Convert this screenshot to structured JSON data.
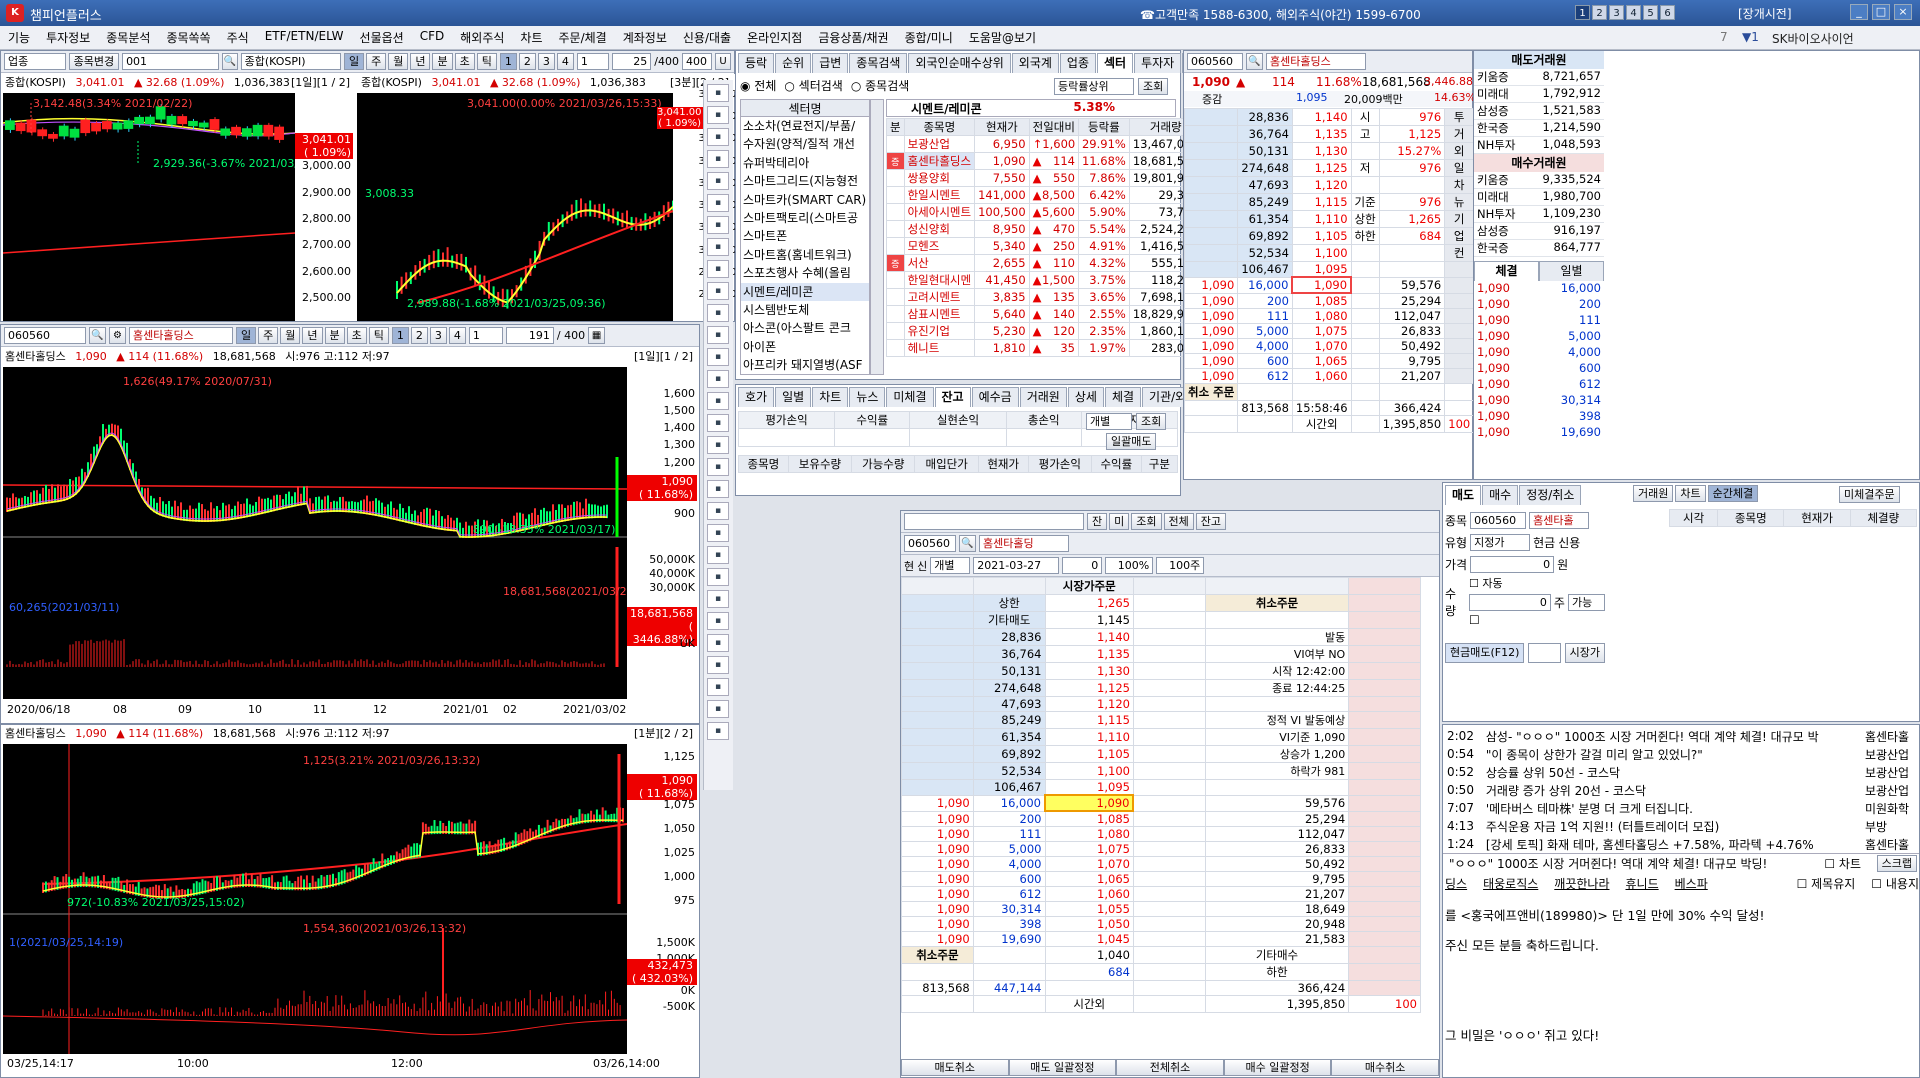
{
  "app": {
    "title": "챔피언플러스",
    "logo": "K",
    "call_center": "☎고객만족 1588-6300, 해외주식(야간) 1599-6700",
    "pages": [
      "1",
      "2",
      "3",
      "4",
      "5",
      "6"
    ],
    "market_status": "[장개시전]",
    "window_buttons": [
      "_",
      "□",
      "×"
    ]
  },
  "menu": [
    "기능",
    "투자정보",
    "종목분석",
    "종목쏙쏙",
    "주식",
    "ETF/ETN/ELW",
    "선물옵션",
    "CFD",
    "해외주식",
    "차트",
    "주문/체결",
    "계좌정보",
    "신용/대출",
    "온라인지점",
    "금융상품/채권",
    "종합/미니",
    "도움말@보기"
  ],
  "menu_extra": {
    "num": "7",
    "num2": "▼1",
    "promo": "SK바이오사이언"
  },
  "index_win": {
    "type": "업종",
    "change_btn": "종목변경",
    "code": "001",
    "name": "종합(KOSPI)",
    "periods": [
      "일",
      "주",
      "월",
      "년",
      "분",
      "초",
      "틱"
    ],
    "nums": [
      "1",
      "2",
      "3",
      "4"
    ],
    "sel1": "1",
    "count": "25",
    "max": "/400",
    "max2": "400",
    "info_left": {
      "name": "종합(KOSPI)",
      "price": "3,041.01",
      "chg": "▲ 32.68 (1.09%)",
      "vol": "1,036,383",
      "page": "[1일][1 / 2]"
    },
    "info_right": {
      "name": "종합(KOSPI)",
      "price": "3,041.01",
      "chg": "▲ 32.68 (1.09%)",
      "vol": "1,036,383",
      "page": "[3분][2 / 2]"
    },
    "left_axis": [
      "3,100.00",
      "3,000.00",
      "2,900.00",
      "2,800.00",
      "2,700.00",
      "2,600.00",
      "2,500.00"
    ],
    "left_price": "3,041.01",
    "left_pct": "( 1.09%)",
    "left_high": "3,142.48(3.34% 2021/02/22)",
    "left_low": "2,929.36(-3.67% 2021/03/09)",
    "right_axis": [
      "3,035.00",
      "3,030.00",
      "3,025.00",
      "3,020.00",
      "3,015.00",
      "3,010.00",
      "3,005.00",
      "3,000.00",
      "2,995.00",
      "2,990.00"
    ],
    "right_price": "3,041.00",
    "right_pct": "( 1.09%)",
    "right_high": "3,041.00(0.00% 2021/03/26,15:33)",
    "right_low": "2,989.88(-1.68% 2021/03/25,09:36)",
    "right_mid": "3,008.33"
  },
  "stock_win": {
    "code": "060560",
    "name": "홈센타홀딩스",
    "periods": [
      "일",
      "주",
      "월",
      "년",
      "분",
      "초",
      "틱"
    ],
    "nums": [
      "1",
      "2",
      "3",
      "4"
    ],
    "sel1": "1",
    "count": "191",
    "max": "/ 400",
    "info": {
      "name": "홈센타홀딩스",
      "price": "1,090",
      "chg": "▲ 114 (11.68%)",
      "vol": "18,681,568",
      "ohl": "시:976 고:112 저:97",
      "page": "[1일][1 / 2]"
    },
    "price_axis": [
      "1,600",
      "1,500",
      "1,400",
      "1,300",
      "1,200",
      "1,100",
      "1,000",
      "900"
    ],
    "vol_axis": [
      "50,000K",
      "40,000K",
      "30,000K"
    ],
    "cur": "1,090",
    "cur_pct": "( 11.68%)",
    "high": "1,626(49.17% 2020/07/31)",
    "low": "890(-18.35% 2021/03/17)",
    "vol_label": "18,681,568(2021/03/26)",
    "vol_cur": "18,681,568",
    "vol_pct": "( 3446.88%)",
    "vol_left": "60,265(2021/03/11)",
    "unit": "UK",
    "dates": [
      "2020/06/18",
      "08",
      "09",
      "10",
      "11",
      "12",
      "2021/01",
      "02",
      "2021/03/02"
    ]
  },
  "minute_win": {
    "info": {
      "name": "홈센타홀딩스",
      "price": "1,090",
      "chg": "▲ 114 (11.68%)",
      "vol": "18,681,568",
      "ohl": "시:976 고:112 저:97",
      "page": "[1분][2 / 2]"
    },
    "price_axis": [
      "1,125",
      "1,100",
      "1,075",
      "1,050",
      "1,025",
      "1,000",
      "975"
    ],
    "vol_axis": [
      "1,500K",
      "1,000K",
      "500K",
      "0K",
      "-500K"
    ],
    "cur": "1,090",
    "cur_pct": "( 11.68%)",
    "high": "1,125(3.21% 2021/03/26,13:32)",
    "low": "972(-10.83% 2021/03/25,15:02)",
    "vol_high": "1,554,360(2021/03/26,13:32)",
    "vol_cur": "432,473",
    "vol_pct": "( 432.03%)",
    "vol_left": "1(2021/03/25,14:19)",
    "dates": [
      "03/25,14:17",
      "10:00",
      "12:00",
      "03/26,14:00"
    ]
  },
  "sector_win": {
    "tabs": [
      "등락",
      "순위",
      "급변",
      "종목검색",
      "외국인순매수상위",
      "외국계",
      "업종",
      "섹터",
      "투자자",
      "프"
    ],
    "radios": [
      "전체",
      "섹터검색",
      "종목검색"
    ],
    "sort": "등락률상위",
    "query": "조회",
    "sector_header": "섹터명",
    "sector_sel": "시멘트/레미콘",
    "sector_pct": "5.38%",
    "sectors": [
      "소소차(연료전지/부품/",
      "수자원(양적/질적 개선",
      "슈퍼박테리아",
      "스마트그리드(지능형전",
      "스마트카(SMART CAR)",
      "스마트팩토리(스마트공",
      "스마트폰",
      "스마트홈(홈네트워크)",
      "스포츠행사 수혜(올림",
      "시멘트/레미콘",
      "시스템반도체",
      "아스콘(아스팔트 콘크",
      "아이폰",
      "아프리카 돼지열병(ASF"
    ],
    "cols": [
      "분",
      "종목명",
      "현재가",
      "전일대비",
      "등락률",
      "거래량"
    ],
    "rows": [
      {
        "m": "",
        "n": "보광산업",
        "p": "6,950",
        "a": "↑",
        "d": "1,600",
        "r": "29.91%",
        "v": "13,467,077",
        "nc": "red"
      },
      {
        "m": "증",
        "n": "홈센타홀딩스",
        "p": "1,090",
        "a": "▲",
        "d": "114",
        "r": "11.68%",
        "v": "18,681,568",
        "nc": "red"
      },
      {
        "m": "",
        "n": "쌍용양회",
        "p": "7,550",
        "a": "▲",
        "d": "550",
        "r": "7.86%",
        "v": "19,801,958",
        "nc": "red"
      },
      {
        "m": "",
        "n": "한일시멘트",
        "p": "141,000",
        "a": "▲",
        "d": "8,500",
        "r": "6.42%",
        "v": "29,378",
        "nc": "red"
      },
      {
        "m": "",
        "n": "아세아시멘트",
        "p": "100,500",
        "a": "▲",
        "d": "5,600",
        "r": "5.90%",
        "v": "73,727",
        "nc": "red"
      },
      {
        "m": "",
        "n": "성신양회",
        "p": "8,950",
        "a": "▲",
        "d": "470",
        "r": "5.54%",
        "v": "2,524,272",
        "nc": "red"
      },
      {
        "m": "",
        "n": "모헨즈",
        "p": "5,340",
        "a": "▲",
        "d": "250",
        "r": "4.91%",
        "v": "1,416,590",
        "nc": "red"
      },
      {
        "m": "증",
        "n": "서산",
        "p": "2,655",
        "a": "▲",
        "d": "110",
        "r": "4.32%",
        "v": "555,152",
        "nc": "red"
      },
      {
        "m": "",
        "n": "한일현대시멘",
        "p": "41,450",
        "a": "▲",
        "d": "1,500",
        "r": "3.75%",
        "v": "118,253",
        "nc": "red"
      },
      {
        "m": "",
        "n": "고려시멘트",
        "p": "3,835",
        "a": "▲",
        "d": "135",
        "r": "3.65%",
        "v": "7,698,190",
        "nc": "red"
      },
      {
        "m": "",
        "n": "삼표시멘트",
        "p": "5,640",
        "a": "▲",
        "d": "140",
        "r": "2.55%",
        "v": "18,829,924",
        "nc": "red"
      },
      {
        "m": "",
        "n": "유진기업",
        "p": "5,230",
        "a": "▲",
        "d": "120",
        "r": "2.35%",
        "v": "1,860,137",
        "nc": "red"
      },
      {
        "m": "",
        "n": "헤니트",
        "p": "1,810",
        "a": "▲",
        "d": "35",
        "r": "1.97%",
        "v": "283,027",
        "nc": "red"
      }
    ]
  },
  "account_win": {
    "tabs": [
      "호가",
      "일별",
      "차트",
      "뉴스",
      "미체결",
      "잔고",
      "예수금",
      "거래원",
      "상세",
      "체결",
      "기관/외인"
    ],
    "summary": [
      "평가손익",
      "수익률",
      "실현손익",
      "총손익",
      "추정자산"
    ],
    "mode": "개별",
    "query": "조회",
    "sell_all": "일괄매도",
    "cols": [
      "종목명",
      "보유수량",
      "가능수량",
      "매입단가",
      "현재가",
      "평가손익",
      "수익률",
      "구분"
    ]
  },
  "order_win": {
    "code": "060560",
    "name": "홈센타홀딩",
    "btns": [
      "잔",
      "미",
      "조회",
      "전체",
      "잔고"
    ],
    "radios": [
      "현",
      "신"
    ],
    "mode": "개별",
    "date": "2021-03-27",
    "qty": "0",
    "pct": "100%",
    "vol": "100주",
    "market_price_order": "시장가주문",
    "upper_label": "상한",
    "upper": "1,265",
    "etc_sell": "기타매도",
    "etc_val": "1,145",
    "cancel": "취소주문",
    "cancel2": "취소주문",
    "asks": [
      [
        "28,836",
        "1,140"
      ],
      [
        "36,764",
        "1,135"
      ],
      [
        "50,131",
        "1,130"
      ],
      [
        "274,648",
        "1,125"
      ],
      [
        "47,693",
        "1,120"
      ],
      [
        "85,249",
        "1,115"
      ],
      [
        "61,354",
        "1,110"
      ],
      [
        "69,892",
        "1,105"
      ],
      [
        "52,534",
        "1,100"
      ],
      [
        "106,467",
        "1,095"
      ]
    ],
    "bids": [
      [
        "1,090",
        "16,000",
        "1,090",
        "59,576"
      ],
      [
        "1,090",
        "200",
        "1,085",
        "25,294"
      ],
      [
        "1,090",
        "111",
        "1,080",
        "112,047"
      ],
      [
        "1,090",
        "5,000",
        "1,075",
        "26,833"
      ],
      [
        "1,090",
        "4,000",
        "1,070",
        "50,492"
      ],
      [
        "1,090",
        "600",
        "1,065",
        "9,795"
      ],
      [
        "1,090",
        "612",
        "1,060",
        "21,207"
      ],
      [
        "1,090",
        "30,314",
        "1,055",
        "18,649"
      ],
      [
        "1,090",
        "398",
        "1,050",
        "20,948"
      ],
      [
        "1,090",
        "19,690",
        "1,045",
        "21,583"
      ]
    ],
    "info": [
      [
        "발동",
        ""
      ],
      [
        "VI여부",
        "NO"
      ],
      [
        "시작",
        "12:42:00"
      ],
      [
        "종료",
        "12:44:25"
      ],
      [
        "",
        ""
      ],
      [
        "정적 VI 발동예상",
        ""
      ],
      [
        "VI기준",
        "1,090"
      ],
      [
        "상승가",
        "1,200"
      ],
      [
        "하락가",
        "981"
      ]
    ],
    "side_btns": [
      "투",
      "거",
      "외",
      "일",
      "차",
      "뉴",
      "기",
      "업",
      "컨"
    ],
    "bottom": {
      "low_val": "1,040",
      "low_label": "하한",
      "etc_buy": "기타매수",
      "low_price": "684",
      "total_ask": "813,568",
      "total_bid": "447,144",
      "after_label": "시간외",
      "after_ask": "366,424",
      "after_bid": "1,395,850",
      "hundred": "100"
    },
    "footer": [
      "매도취소",
      "매도 일괄정정",
      "전체취소",
      "매수 일괄정정",
      "매수취소"
    ]
  },
  "quote_win": {
    "code": "060560",
    "name": "홈센타홀딩스",
    "price": "1,090",
    "chg": "▲",
    "diff": "114",
    "pct": "11.68%",
    "vol": "18,681,568",
    "vol_pct": "3,446.88%",
    "prev_label": "증감",
    "prev": "1,095",
    "amt": "20,009백만",
    "amt_pct": "14.63%",
    "asks": [
      [
        "28,836",
        "1,140"
      ],
      [
        "36,764",
        "1,135"
      ],
      [
        "50,131",
        "1,130"
      ],
      [
        "274,648",
        "1,125"
      ],
      [
        "47,693",
        "1,120"
      ],
      [
        "85,249",
        "1,115"
      ],
      [
        "61,354",
        "1,110"
      ],
      [
        "69,892",
        "1,105"
      ],
      [
        "52,534",
        "1,100"
      ],
      [
        "106,467",
        "1,095"
      ]
    ],
    "bids": [
      [
        "1,090",
        "16,000",
        "1,090",
        "59,576"
      ],
      [
        "1,090",
        "200",
        "1,085",
        "25,294"
      ],
      [
        "1,090",
        "111",
        "1,080",
        "112,047"
      ],
      [
        "1,090",
        "5,000",
        "1,075",
        "26,833"
      ],
      [
        "1,090",
        "4,000",
        "1,070",
        "50,492"
      ],
      [
        "1,090",
        "600",
        "1,065",
        "9,795"
      ],
      [
        "1,090",
        "612",
        "1,060",
        "21,207"
      ]
    ],
    "stats": [
      [
        "시",
        "976"
      ],
      [
        "고",
        "1,125"
      ],
      [
        "",
        "15.27%"
      ],
      [
        "저",
        "976"
      ],
      [
        "",
        ""
      ],
      [
        "기준",
        "976"
      ],
      [
        "상한",
        "1,265"
      ],
      [
        "하한",
        "684"
      ]
    ],
    "side": [
      "투",
      "거",
      "외",
      "일",
      "차",
      "뉴",
      "기",
      "업",
      "컨"
    ],
    "cancel": "취소 주문",
    "total_ask": "813,568",
    "time": "15:58:46",
    "total_bid": "366,424",
    "after_label": "시간외",
    "after_bid": "1,395,850",
    "hundred": "100"
  },
  "broker_win": {
    "sell_title": "매도거래원",
    "sell": [
      [
        "키움증",
        "8,721,657"
      ],
      [
        "미래대",
        "1,792,912"
      ],
      [
        "삼성증",
        "1,521,583"
      ],
      [
        "한국증",
        "1,214,590"
      ],
      [
        "NH투자",
        "1,048,593"
      ]
    ],
    "buy_title": "매수거래원",
    "buy": [
      [
        "키움증",
        "9,335,524"
      ],
      [
        "미래대",
        "1,980,700"
      ],
      [
        "NH투자",
        "1,109,230"
      ],
      [
        "삼성증",
        "916,197"
      ],
      [
        "한국증",
        "864,777"
      ]
    ],
    "tabs": [
      "체결",
      "일별"
    ],
    "trades": [
      [
        "1,090",
        "16,000"
      ],
      [
        "1,090",
        "200"
      ],
      [
        "1,090",
        "111"
      ],
      [
        "1,090",
        "5,000"
      ],
      [
        "1,090",
        "4,000"
      ],
      [
        "1,090",
        "600"
      ],
      [
        "1,090",
        "612"
      ],
      [
        "1,090",
        "30,314"
      ],
      [
        "1,090",
        "398"
      ],
      [
        "1,090",
        "19,690"
      ]
    ]
  },
  "order_form": {
    "tabs": [
      "매도",
      "매수",
      "정정/취소"
    ],
    "code": "060560",
    "name": "홈센타홀",
    "type_label": "유형",
    "type": "지정가",
    "cash": "현금",
    "credit": "신용",
    "price_label": "가격",
    "price": "0",
    "won": "원",
    "auto": "자동",
    "qty_label": "수량",
    "qty": "0",
    "ju": "주",
    "avail": "가능",
    "submit": "현금매도(F12)",
    "market": "시장가",
    "row_labels": [
      "종목"
    ],
    "right_tabs": [
      "거래원",
      "차트",
      "순간체결"
    ],
    "unfilled": "미체결주문",
    "list_cols": [
      "시각",
      "종목명",
      "현재가",
      "체결량"
    ]
  },
  "news_win": {
    "items": [
      {
        "t": "2:02",
        "txt": "삼성- \"ㅇㅇㅇ\" 1000조 시장 거머쥔다! 역대 계약 체결! 대규모 박",
        "s": "홈센타홀"
      },
      {
        "t": "0:54",
        "txt": "\"이 종목이 상한가 갈걸 미리 알고 있었니?\"",
        "s": "보광산업"
      },
      {
        "t": "0:52",
        "txt": "상승률 상위 50선 - 코스닥",
        "s": "보광산업"
      },
      {
        "t": "0:50",
        "txt": "거래량 증가 상위 20선 - 코스닥",
        "s": "보광산업"
      },
      {
        "t": "7:07",
        "txt": "'메타버스 테마株' 분명 더 크게 터집니다.",
        "s": "미원화학"
      },
      {
        "t": "4:13",
        "txt": "주식운용 자금 1억 지원!! (터틀트레이더 모집)",
        "s": "부방"
      },
      {
        "t": "1:24",
        "txt": "[강세 토픽] 화재 테마, 홈센타홀딩스 +7.58%, 파라텍 +4.76%",
        "s": "홈센타홀"
      }
    ],
    "ticker": "\"ㅇㅇㅇ\" 1000조 시장 거머쥔다! 역대 계약 체결! 대규모 박딩!",
    "ticker_btns": [
      "차트",
      "스크랩"
    ],
    "links": [
      "딩스",
      "태웅로직스",
      "깨끗한나라",
      "휴니드",
      "베스파"
    ],
    "checks": [
      "제목유지",
      "내용지"
    ],
    "body": [
      "를 <홍국에프앤비(189980)> 단 1일 만에 30% 수익 달성!",
      "주신 모든 분들 축하드립니다.",
      "그 비밀은 'ㅇㅇㅇ' 쥐고 있다!"
    ]
  }
}
